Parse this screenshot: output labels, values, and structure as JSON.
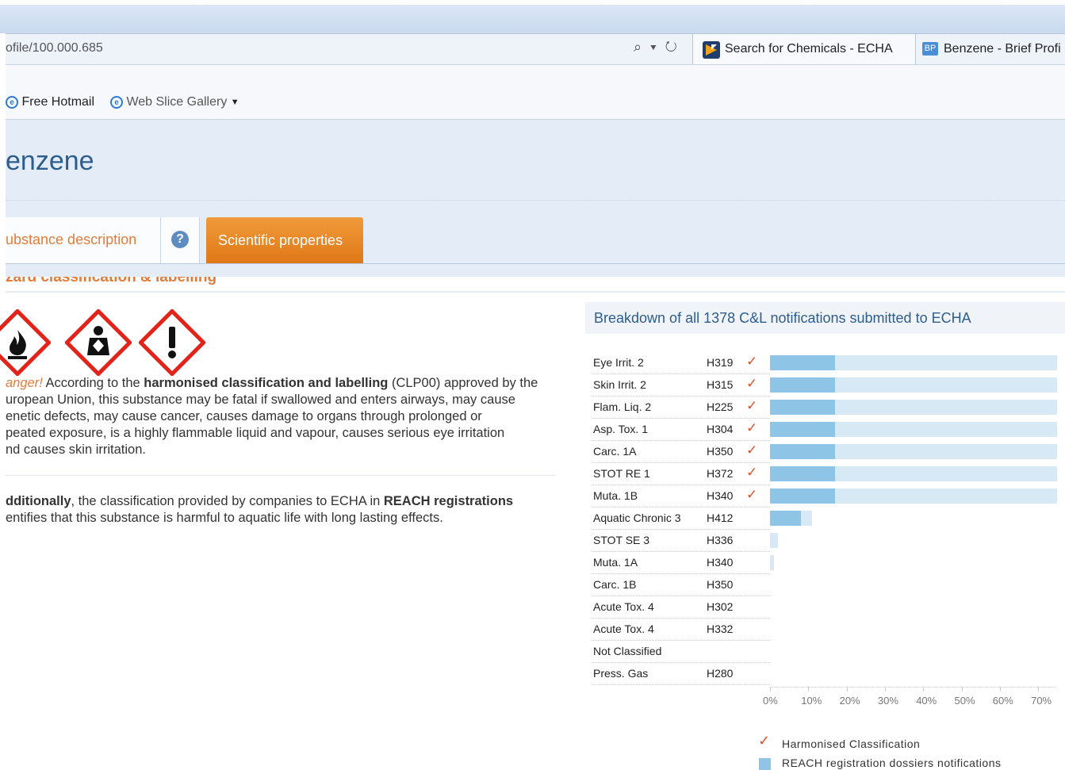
{
  "browser": {
    "url": "ofile/100.000.685",
    "address_icons": "⌕ ▾ ↻",
    "tabs": [
      {
        "label": "Search for Chemicals - ECHA",
        "icon": "echa-logo-icon"
      },
      {
        "label": "Benzene - Brief Profi",
        "icon": "bp-icon",
        "icon_text": "BP"
      }
    ],
    "favorites": [
      {
        "label": "Free Hotmail",
        "icon": "ie-page-icon"
      },
      {
        "label": "Web Slice Gallery",
        "icon": "ie-page-icon",
        "dropdown": "▼"
      }
    ]
  },
  "page": {
    "title": "enzene",
    "tabs": [
      {
        "label": "ubstance description"
      },
      {
        "label": "?"
      },
      {
        "label": "Scientific properties"
      }
    ],
    "section_header": "zard classification & labelling",
    "pictograms": [
      "flammable-pictogram-icon",
      "health-hazard-pictogram-icon",
      "exclamation-pictogram-icon"
    ],
    "paragraph1": {
      "lead": "anger!",
      "t1": " According to the ",
      "b1": "harmonised classification and labelling",
      "t2": " (CLP00) approved by the",
      "line2": "uropean Union, this substance may be fatal if swallowed and enters airways, may cause",
      "line3": "enetic defects, may cause cancer, causes damage to organs through prolonged or",
      "line4": "peated exposure, is a highly flammable liquid and vapour, causes serious eye irritation",
      "line5": "nd causes skin irritation."
    },
    "paragraph2": {
      "b1": "dditionally",
      "t1": ", the classification provided by companies to ECHA in ",
      "b2": "REACH registrations",
      "line2": "entifies that this substance is harmful to aquatic life with long lasting effects."
    }
  },
  "chart_panel": {
    "title": "Breakdown of all 1378 C&L notifications submitted to ECHA",
    "legend": {
      "check_label": "Harmonised Classification",
      "bar_label": "REACH registration dossiers notifications"
    }
  },
  "chart_data": {
    "type": "bar",
    "orientation": "horizontal",
    "title": "Breakdown of all 1378 C&L notifications submitted to ECHA",
    "x_ticks": [
      "0%",
      "10%",
      "20%",
      "30%",
      "40%",
      "50%",
      "60%",
      "70%"
    ],
    "xlim": [
      0,
      75
    ],
    "colors": {
      "light": "#d6e9f5",
      "dark": "#8ec5e6",
      "check": "#d9542b"
    },
    "categories": [
      {
        "name": "Eye Irrit. 2",
        "code": "H319",
        "harmonised": true,
        "total_pct": 75,
        "reach_pct": 17
      },
      {
        "name": "Skin Irrit. 2",
        "code": "H315",
        "harmonised": true,
        "total_pct": 75,
        "reach_pct": 17
      },
      {
        "name": "Flam. Liq. 2",
        "code": "H225",
        "harmonised": true,
        "total_pct": 75,
        "reach_pct": 17
      },
      {
        "name": "Asp. Tox. 1",
        "code": "H304",
        "harmonised": true,
        "total_pct": 75,
        "reach_pct": 17
      },
      {
        "name": "Carc. 1A",
        "code": "H350",
        "harmonised": true,
        "total_pct": 75,
        "reach_pct": 17
      },
      {
        "name": "STOT RE 1",
        "code": "H372",
        "harmonised": true,
        "total_pct": 75,
        "reach_pct": 17
      },
      {
        "name": "Muta. 1B",
        "code": "H340",
        "harmonised": true,
        "total_pct": 75,
        "reach_pct": 17
      },
      {
        "name": "Aquatic Chronic 3",
        "code": "H412",
        "harmonised": false,
        "total_pct": 11,
        "reach_pct": 8
      },
      {
        "name": "STOT SE 3",
        "code": "H336",
        "harmonised": false,
        "total_pct": 2,
        "reach_pct": 0
      },
      {
        "name": "Muta. 1A",
        "code": "H340",
        "harmonised": false,
        "total_pct": 1,
        "reach_pct": 0
      },
      {
        "name": "Carc. 1B",
        "code": "H350",
        "harmonised": false,
        "total_pct": 0,
        "reach_pct": 0
      },
      {
        "name": "Acute Tox. 4",
        "code": "H302",
        "harmonised": false,
        "total_pct": 0,
        "reach_pct": 0
      },
      {
        "name": "Acute Tox. 4",
        "code": "H332",
        "harmonised": false,
        "total_pct": 0,
        "reach_pct": 0
      },
      {
        "name": "Not Classified",
        "code": "",
        "harmonised": false,
        "total_pct": 0,
        "reach_pct": 0
      },
      {
        "name": "Press. Gas",
        "code": "H280",
        "harmonised": false,
        "total_pct": 0,
        "reach_pct": 0
      }
    ]
  }
}
